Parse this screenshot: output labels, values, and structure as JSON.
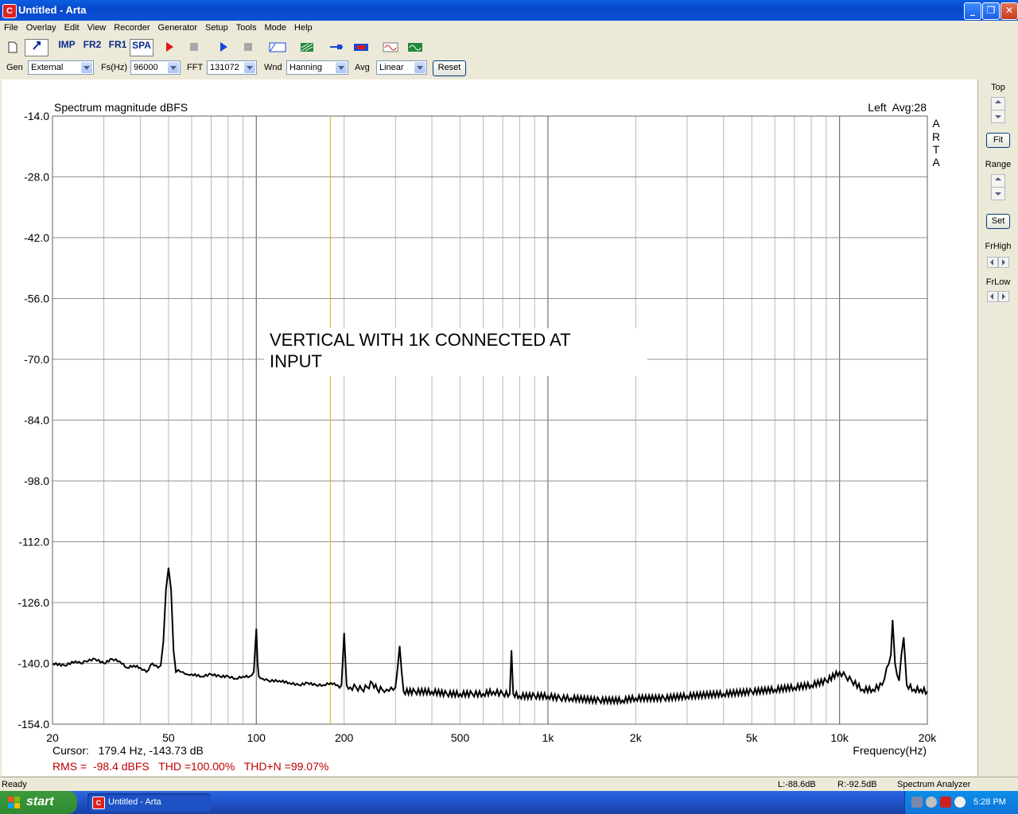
{
  "window": {
    "title": "Untitled - Arta",
    "app_icon_letter": "C",
    "minimize": "_",
    "maximize": "❐",
    "close": "✕"
  },
  "menu": [
    "File",
    "Overlay",
    "Edit",
    "View",
    "Recorder",
    "Generator",
    "Setup",
    "Tools",
    "Mode",
    "Help"
  ],
  "toolbar": {
    "imp": "IMP",
    "fr2": "FR2",
    "fr1": "FR1",
    "spa": "SPA"
  },
  "params": {
    "gen_label": "Gen",
    "gen_value": "External",
    "fs_label": "Fs(Hz)",
    "fs_value": "96000",
    "fft_label": "FFT",
    "fft_value": "131072",
    "wnd_label": "Wnd",
    "wnd_value": "Hanning",
    "avg_label": "Avg",
    "avg_value": "Linear",
    "reset": "Reset"
  },
  "side": {
    "top": "Top",
    "fit": "Fit",
    "range": "Range",
    "set": "Set",
    "frhigh": "FrHigh",
    "frlow": "FrLow"
  },
  "plot": {
    "title": "Spectrum magnitude dBFS",
    "channel": "Left  Avg:28",
    "watermark": [
      "A",
      "R",
      "T",
      "A"
    ],
    "annotation_line1": "VERTICAL WITH 1K CONNECTED AT",
    "annotation_line2": "INPUT",
    "cursor_text": "Cursor:   179.4 Hz, -143.73 dB",
    "metrics_text": "RMS =  -98.4 dBFS   THD =100.00%   THD+N =99.07%",
    "xlabel": "Frequency(Hz)",
    "colors": {
      "trace": "#000000",
      "cursor": "#d8b000",
      "grid": "#808080",
      "metrics": "#c00000"
    }
  },
  "chart_data": {
    "type": "line",
    "title": "Spectrum magnitude dBFS",
    "xlabel": "Frequency(Hz)",
    "ylabel": "",
    "x_scale": "log",
    "xlim": [
      20,
      20000
    ],
    "ylim": [
      -154,
      -14
    ],
    "x_ticks": [
      {
        "v": 20,
        "label": "20"
      },
      {
        "v": 50,
        "label": "50"
      },
      {
        "v": 100,
        "label": "100"
      },
      {
        "v": 200,
        "label": "200"
      },
      {
        "v": 500,
        "label": "500"
      },
      {
        "v": 1000,
        "label": "1k"
      },
      {
        "v": 2000,
        "label": "2k"
      },
      {
        "v": 5000,
        "label": "5k"
      },
      {
        "v": 10000,
        "label": "10k"
      },
      {
        "v": 20000,
        "label": "20k"
      }
    ],
    "y_ticks": [
      {
        "v": -14,
        "label": "-14.0"
      },
      {
        "v": -28,
        "label": "-28.0"
      },
      {
        "v": -42,
        "label": "-42.0"
      },
      {
        "v": -56,
        "label": "-56.0"
      },
      {
        "v": -70,
        "label": "-70.0"
      },
      {
        "v": -84,
        "label": "-84.0"
      },
      {
        "v": -98,
        "label": "-98.0"
      },
      {
        "v": -112,
        "label": "-112.0"
      },
      {
        "v": -126,
        "label": "-126.0"
      },
      {
        "v": -140,
        "label": "-140.0"
      },
      {
        "v": -154,
        "label": "-154.0"
      }
    ],
    "cursor_hz": 179.4,
    "grid": true,
    "series": [
      {
        "x": [
          20,
          22,
          24,
          25,
          26,
          28,
          30,
          32,
          34,
          36,
          38,
          40,
          42,
          44,
          46,
          47,
          48,
          49,
          50,
          51,
          52,
          53,
          54,
          56,
          58,
          60,
          65,
          70,
          75,
          80,
          85,
          90,
          95,
          98,
          100,
          101,
          102,
          105,
          110,
          120,
          130,
          140,
          150,
          160,
          170,
          180,
          190,
          196,
          200,
          204,
          210,
          220,
          230,
          240,
          250,
          260,
          270,
          280,
          290,
          300,
          310,
          320,
          350,
          400,
          450,
          500,
          550,
          600,
          650,
          700,
          740,
          750,
          760,
          800,
          900,
          1000,
          1100,
          1200,
          1500,
          1800,
          2000,
          2500,
          3000,
          4000,
          5000,
          6000,
          7000,
          8000,
          9000,
          10000,
          10500,
          11000,
          12000,
          13000,
          14000,
          14500,
          15000,
          15200,
          15500,
          16000,
          16300,
          16600,
          17000,
          18000,
          19000,
          20000
        ],
        "y": [
          -140,
          -140.5,
          -139.5,
          -140,
          -139.5,
          -139,
          -140,
          -139,
          -139.5,
          -141,
          -140.5,
          -141,
          -142,
          -140,
          -141,
          -140.5,
          -135,
          -123,
          -118,
          -123,
          -137,
          -142,
          -141.5,
          -142,
          -142.5,
          -142.5,
          -143,
          -142.5,
          -143,
          -143,
          -143.5,
          -143,
          -143,
          -142,
          -132,
          -140,
          -143,
          -143.5,
          -144,
          -144,
          -144.5,
          -145,
          -144.5,
          -145,
          -145,
          -144.5,
          -145,
          -145,
          -133,
          -145,
          -145.5,
          -145.5,
          -146,
          -145.5,
          -144.5,
          -146,
          -146,
          -146,
          -145.5,
          -145.5,
          -136,
          -146.5,
          -146.5,
          -146.5,
          -147,
          -147,
          -147,
          -147,
          -146.5,
          -147,
          -147,
          -137,
          -147,
          -147.5,
          -147.5,
          -147.5,
          -148,
          -148,
          -148.5,
          -148.5,
          -148,
          -148,
          -147.5,
          -147,
          -146.5,
          -146,
          -145.5,
          -145,
          -144,
          -142,
          -143,
          -144,
          -146,
          -146,
          -145,
          -141,
          -138,
          -130,
          -140,
          -144,
          -138,
          -134,
          -145,
          -146,
          -146,
          -146.5
        ]
      }
    ]
  }
}
